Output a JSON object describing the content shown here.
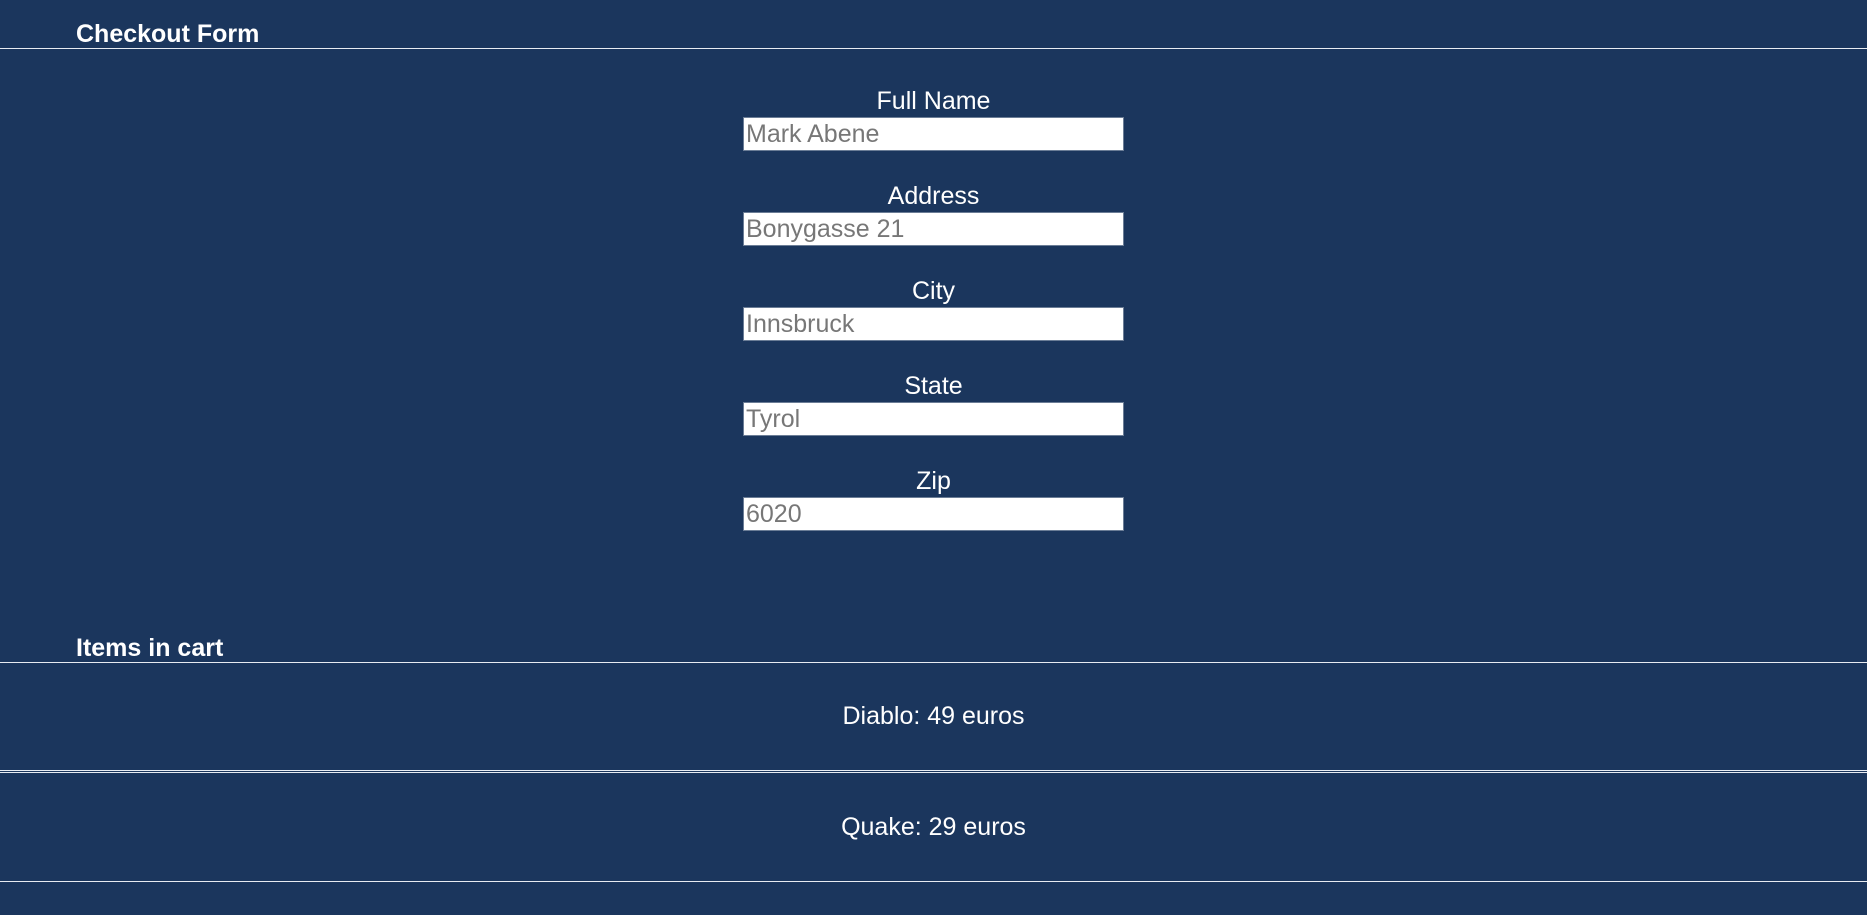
{
  "checkout": {
    "title": "Checkout Form",
    "fields": [
      {
        "label": "Full Name",
        "placeholder": "Mark Abene"
      },
      {
        "label": "Address",
        "placeholder": "Bonygasse 21"
      },
      {
        "label": "City",
        "placeholder": "Innsbruck"
      },
      {
        "label": "State",
        "placeholder": "Tyrol"
      },
      {
        "label": "Zip",
        "placeholder": "6020"
      }
    ]
  },
  "cart": {
    "title": "Items in cart",
    "items": [
      {
        "text": "Diablo: 49 euros"
      },
      {
        "text": "Quake: 29 euros"
      }
    ]
  },
  "colors": {
    "background": "#1b365d",
    "text": "#ffffff",
    "divider": "#e8ecf2",
    "input_background": "#ffffff",
    "placeholder": "#777777"
  }
}
